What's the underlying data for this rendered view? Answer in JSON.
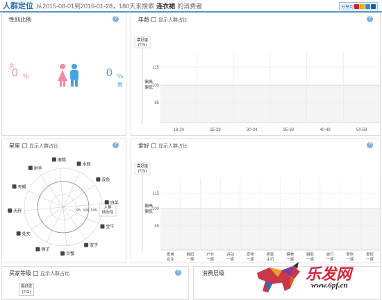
{
  "header": {
    "title": "人群定位",
    "range": "从2015-08-01到2016-01-28，180天来搜索",
    "keyword": "连衣裙",
    "suffix": "的消费者",
    "share_label": "分享到"
  },
  "gender": {
    "title": "性别比例",
    "female_label": "女",
    "female_value": "0",
    "female_unit": "%",
    "male_label": "男",
    "male_value": "0",
    "male_unit": "%",
    "colors": {
      "female": "#f38aa2",
      "male": "#4aa3df"
    }
  },
  "age": {
    "title": "年龄",
    "toggle_label": "显示人群占比",
    "ylabel_line1": "喜好度",
    "ylabel_line2": "(TGI)",
    "band_label_line1": "偏高",
    "band_label_line2": "偏低"
  },
  "constellation": {
    "title": "星座",
    "toggle_label": "显示人群占比",
    "ring_labels": [
      "95",
      "100",
      "105"
    ],
    "center_label_line1": "人群",
    "center_label_line2": "倾向性",
    "signs": [
      "水瓶",
      "双鱼",
      "白羊",
      "金牛",
      "双子",
      "巨蟹",
      "狮子",
      "处女",
      "天秤",
      "天蝎",
      "射手",
      "摩羯"
    ]
  },
  "hobby": {
    "title": "爱好",
    "toggle_label": "显示人群占比",
    "ylabel_line1": "喜好度",
    "ylabel_line2": "(TGI)",
    "band_label_line1": "偏高",
    "band_label_line2": "偏低"
  },
  "buyer_level": {
    "title": "买家等级",
    "toggle_label": "显示人群占比",
    "ylabel_line1": "喜好度",
    "ylabel_line2": "(TGI)"
  },
  "consumption": {
    "title": "消费层级"
  },
  "watermark": {
    "brand": "乐发网",
    "url": "www.6pf.cn"
  },
  "chart_data": [
    {
      "type": "bar",
      "name": "年龄",
      "categories": [
        "18-24",
        "25-29",
        "30-34",
        "35-39",
        "40-49",
        "50-59"
      ],
      "values": [],
      "ylabel": "喜好度 (TGI)",
      "yticks": [
        85,
        100,
        115
      ],
      "reference_line": 100,
      "grid": true
    },
    {
      "type": "bar",
      "name": "爱好",
      "categories": [
        "爱美女生",
        "数码一族",
        "户外一族",
        "运动一族",
        "宠物一族",
        "居家主妇",
        "健美一族",
        "摄影一族",
        "旅行一族",
        "爱吃一族",
        "爱好一族"
      ],
      "values": [],
      "ylabel": "喜好度 (TGI)",
      "yticks": [
        85,
        100,
        115
      ],
      "reference_line": 100,
      "grid": true
    },
    {
      "type": "radar",
      "name": "星座",
      "categories": [
        "水瓶",
        "双鱼",
        "白羊",
        "金牛",
        "双子",
        "巨蟹",
        "狮子",
        "处女",
        "天秤",
        "天蝎",
        "射手",
        "摩羯"
      ],
      "values": [],
      "rings": [
        95,
        100,
        105
      ]
    }
  ]
}
